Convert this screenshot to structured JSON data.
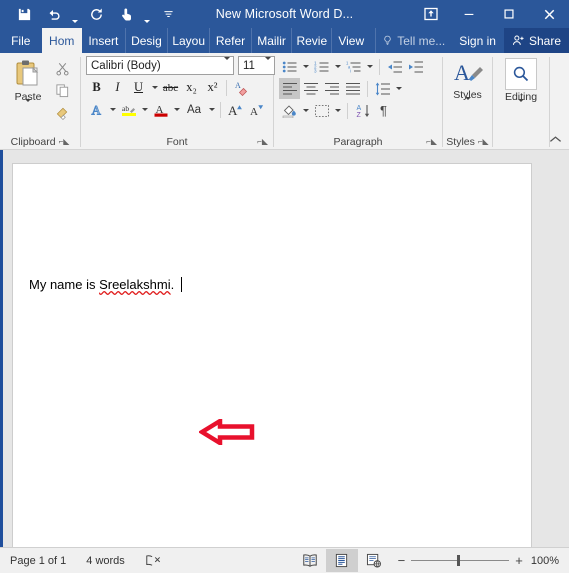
{
  "window": {
    "title": "New Microsoft Word D...",
    "quick_access": [
      {
        "name": "save",
        "label": "Save"
      },
      {
        "name": "undo",
        "label": "Undo"
      },
      {
        "name": "redo",
        "label": "Redo"
      },
      {
        "name": "touch-mouse-mode",
        "label": "Touch/Mouse Mode"
      },
      {
        "name": "customize-quick-access-toolbar",
        "label": "Customize Quick Access Toolbar"
      }
    ],
    "controls": [
      {
        "name": "ribbon-display-options",
        "label": "Ribbon Display Options"
      },
      {
        "name": "minimize",
        "label": "Minimize"
      },
      {
        "name": "maximize",
        "label": "Maximize"
      },
      {
        "name": "close",
        "label": "Close"
      }
    ]
  },
  "tabs": {
    "file": "File",
    "items": [
      {
        "label": "Hom",
        "active": true
      },
      {
        "label": "Insert",
        "active": false
      },
      {
        "label": "Desig",
        "active": false
      },
      {
        "label": "Layou",
        "active": false
      },
      {
        "label": "Refer",
        "active": false
      },
      {
        "label": "Mailir",
        "active": false
      },
      {
        "label": "Revie",
        "active": false
      },
      {
        "label": "View",
        "active": false
      }
    ],
    "tell_me": "Tell me...",
    "sign_in": "Sign in",
    "share": "Share"
  },
  "ribbon": {
    "clipboard": {
      "label": "Clipboard",
      "paste": "Paste",
      "cut": "Cut",
      "copy": "Copy",
      "format_painter": "Format Painter"
    },
    "font": {
      "label": "Font",
      "font_name": "Calibri (Body)",
      "font_size": "11",
      "bold": "B",
      "italic": "I",
      "underline": "U",
      "strikethrough": "abc",
      "subscript": "x₂",
      "superscript": "x²",
      "clear_formatting": "Clear All Formatting",
      "text_effects": "Text Effects and Typography",
      "highlight": "Text Highlight Color",
      "font_color": "Font Color",
      "change_case": "Aa",
      "grow_font": "A",
      "shrink_font": "A"
    },
    "paragraph": {
      "label": "Paragraph",
      "bullets": "Bullets",
      "numbering": "Numbering",
      "multilevel": "Multilevel List",
      "decrease_indent": "Decrease Indent",
      "increase_indent": "Increase Indent",
      "align_left": "Align Left",
      "align_center": "Center",
      "align_right": "Align Right",
      "justify": "Justify",
      "line_spacing": "Line and Paragraph Spacing",
      "shading": "Shading",
      "borders": "Borders",
      "sort": "Sort",
      "show_marks": "¶"
    },
    "styles": {
      "label": "Styles",
      "button": "Styles"
    },
    "editing": {
      "label": "Editing",
      "button": "Editing"
    },
    "collapse_ribbon": "Collapse the Ribbon"
  },
  "document": {
    "text_before": "My name is ",
    "misspelled_word": "Sreelakshmi",
    "text_after": ".",
    "annotation": {
      "name": "red-left-arrow",
      "color": "#e8112d"
    }
  },
  "status_bar": {
    "page": "Page 1 of 1",
    "words": "4 words",
    "proofing": "Proofing errors",
    "views": [
      {
        "name": "read-mode",
        "label": "Read Mode",
        "active": false
      },
      {
        "name": "print-layout",
        "label": "Print Layout",
        "active": true
      },
      {
        "name": "web-layout",
        "label": "Web Layout",
        "active": false
      }
    ],
    "zoom_out": "−",
    "zoom_in": "+",
    "zoom_level": "100%"
  },
  "colors": {
    "title_bar": "#2b579a",
    "ribbon_bg": "#f2f2f2",
    "accent_blue": "#2b579a",
    "annotation_red": "#e8112d"
  }
}
